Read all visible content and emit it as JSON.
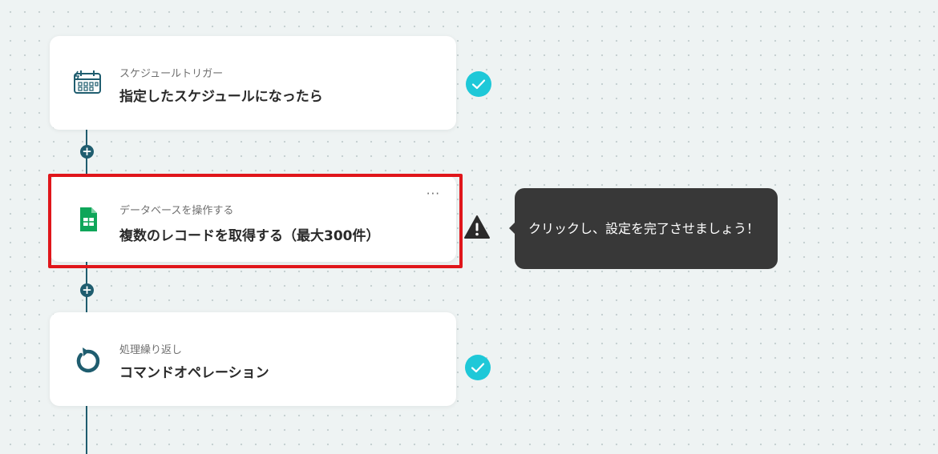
{
  "steps": [
    {
      "category": "スケジュールトリガー",
      "title": "指定したスケジュールになったら",
      "icon": "schedule-trigger-icon",
      "status": "complete"
    },
    {
      "category": "データベースを操作する",
      "title": "複数のレコードを取得する（最大300件）",
      "icon": "google-sheets-icon",
      "status": "warning",
      "more_label": "···"
    },
    {
      "category": "処理繰り返し",
      "title": "コマンドオペレーション",
      "icon": "loop-icon",
      "status": "complete"
    }
  ],
  "add_step_label": "+",
  "tooltip": {
    "text": "クリックし、設定を完了させましょう！"
  },
  "colors": {
    "connector": "#1f5d6f",
    "check": "#1ec8d8",
    "highlight": "#e0161b",
    "tooltip_bg": "#383838",
    "sheets_green": "#0fa65a"
  }
}
